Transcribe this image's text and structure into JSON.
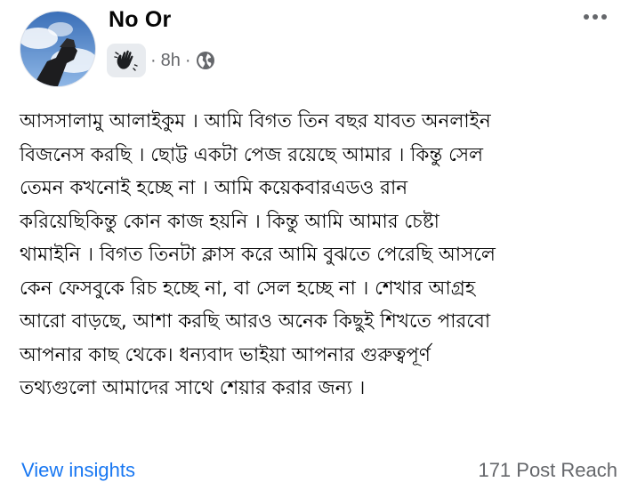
{
  "post": {
    "author_name": "No Or",
    "time": "8h",
    "separator": "·",
    "body_lines": [
      "আসসালামু আলাইকুম । আমি বিগত তিন বছর যাবত অনলাইন",
      "বিজনেস করছি । ছোট্ট একটা পেজ রয়েছে আমার । কিন্তু সেল",
      "তেমন কখনোই হচ্ছে না । আমি কয়েকবারএডও রান",
      "করিয়েছিকিন্তু কোন কাজ হয়নি । কিন্তু আমি আমার চেষ্টা",
      "থামাইনি । বিগত তিনটা ক্লাস করে আমি বুঝতে পেরেছি আসলে",
      "কেন ফেসবুকে রিচ হচ্ছে না, বা সেল হচ্ছে না ।  শেখার আগ্রহ",
      "আরো বাড়ছে, আশা করছি আরও অনেক কিছুই শিখতে পারবো",
      "আপনার কাছ থেকে। ধন্যবাদ ভাইয়া আপনার গুরুত্বপূর্ণ",
      "তথ্যগুলো আমাদের সাথে শেয়ার করার জন্য ।"
    ],
    "insights_label": "View insights",
    "reach_label": "171 Post Reach"
  },
  "icons": {
    "badge": "waving-hand-icon",
    "privacy": "globe-icon",
    "menu": "more-options-icon"
  },
  "colors": {
    "link": "#1877f2",
    "secondary_text": "#65676b",
    "badge_bg": "#e8ebef"
  }
}
